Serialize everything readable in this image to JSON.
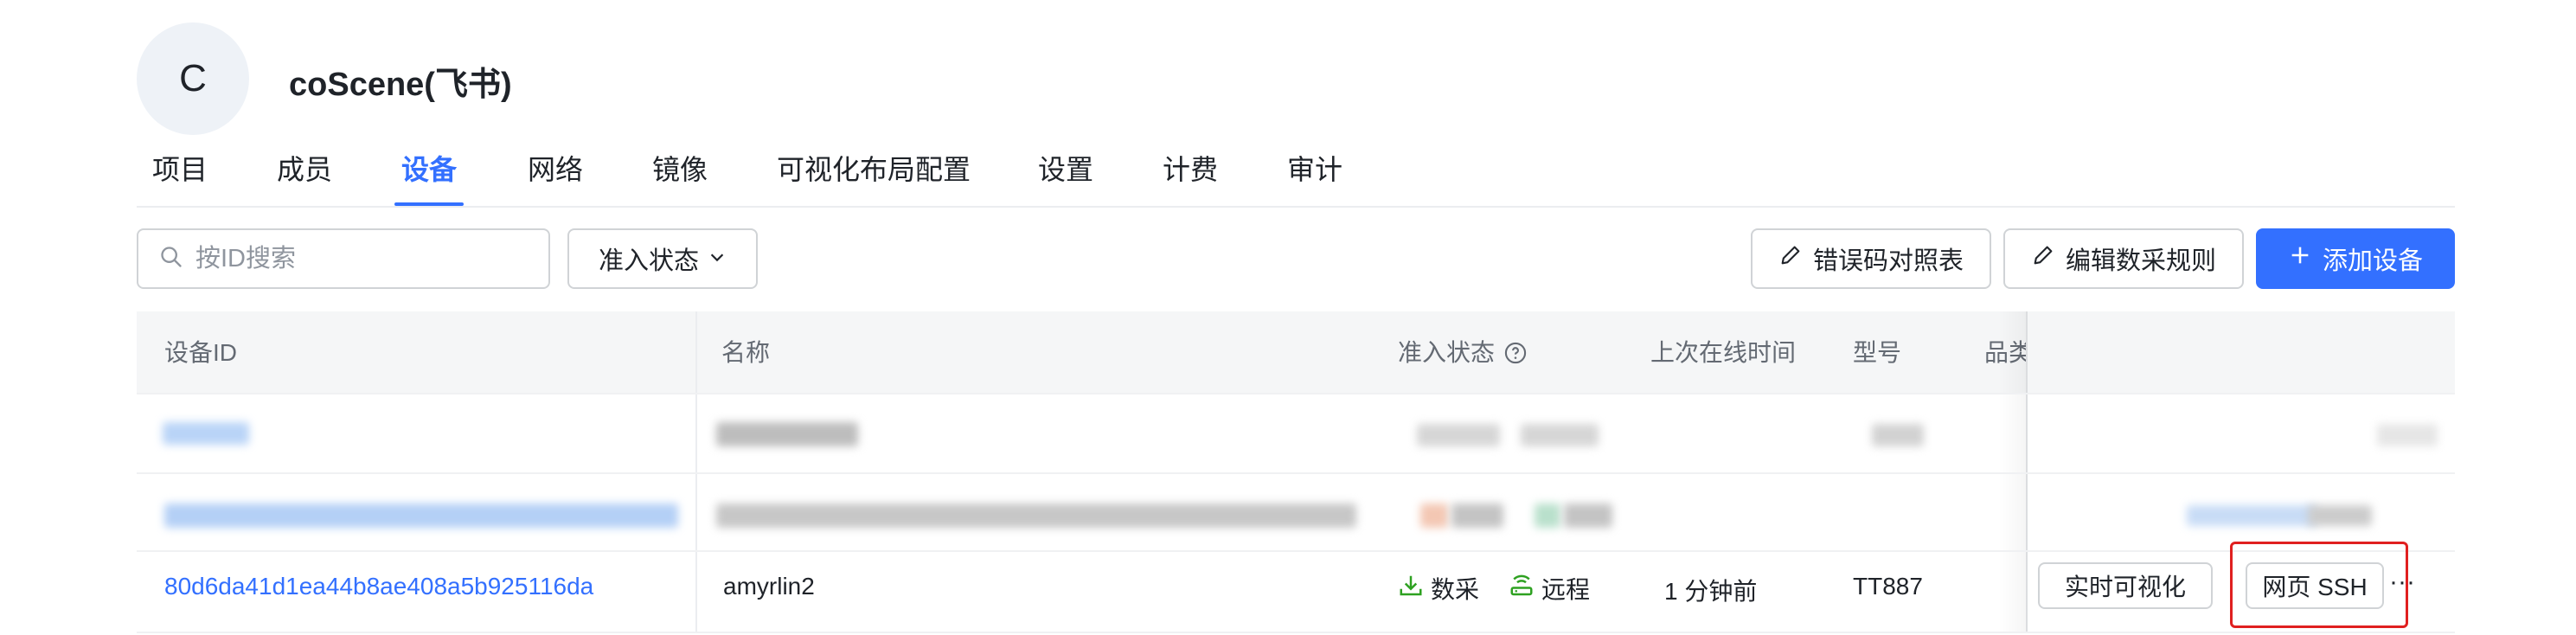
{
  "org": {
    "avatar_letter": "C",
    "name": "coScene(飞书)"
  },
  "tabs": [
    {
      "label": "项目",
      "active": false
    },
    {
      "label": "成员",
      "active": false
    },
    {
      "label": "设备",
      "active": true
    },
    {
      "label": "网络",
      "active": false
    },
    {
      "label": "镜像",
      "active": false
    },
    {
      "label": "可视化布局配置",
      "active": false
    },
    {
      "label": "设置",
      "active": false
    },
    {
      "label": "计费",
      "active": false
    },
    {
      "label": "审计",
      "active": false
    }
  ],
  "toolbar": {
    "search_placeholder": "按ID搜索",
    "filter_label": "准入状态",
    "error_table_label": "错误码对照表",
    "edit_rules_label": "编辑数采规则",
    "add_device_label": "添加设备"
  },
  "table": {
    "columns": [
      "设备ID",
      "名称",
      "准入状态",
      "上次在线时间",
      "型号",
      "品类"
    ],
    "rows": [
      {
        "device_id": "80d6da41d1ea44b8ae408a5b925116da",
        "name": "amyrlin2",
        "status_tags": [
          "数采",
          "远程"
        ],
        "last_online": "1 分钟前",
        "model": "TT887",
        "actions": [
          "实时可视化",
          "网页 SSH"
        ],
        "more": "···"
      }
    ]
  },
  "colors": {
    "accent": "#3370ff",
    "highlight": "#e02020",
    "status_green": "#2ea121"
  },
  "icons": [
    "search-icon",
    "chevron-down-icon",
    "pencil-icon",
    "plus-icon",
    "help-circle-icon",
    "download-icon",
    "router-icon",
    "more-icon"
  ]
}
